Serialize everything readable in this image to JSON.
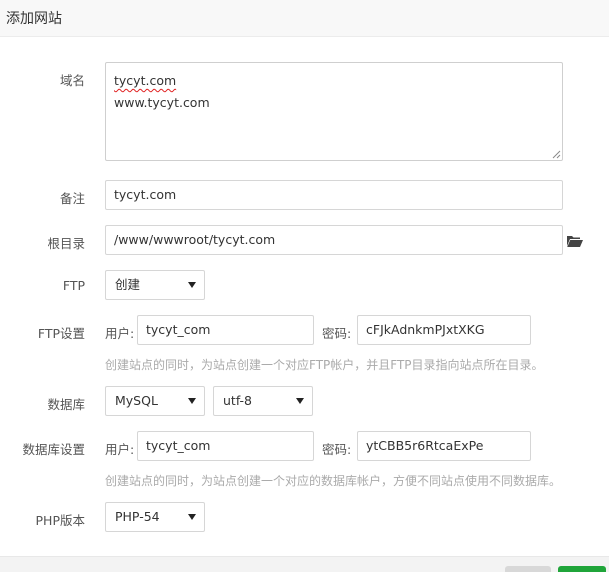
{
  "dialog": {
    "title": "添加网站"
  },
  "domain": {
    "label": "域名",
    "lines": [
      "tycyt.com",
      "www.tycyt.com"
    ]
  },
  "remark": {
    "label": "备注",
    "value": "tycyt.com"
  },
  "root": {
    "label": "根目录",
    "value": "/www/wwwroot/tycyt.com"
  },
  "ftp": {
    "label": "FTP",
    "selected": "创建"
  },
  "ftp_settings": {
    "label": "FTP设置",
    "user_label": "用户:",
    "user_value": "tycyt_com",
    "password_label": "密码:",
    "password_value": "cFJkAdnkmPJxtXKG",
    "hint": "创建站点的同时，为站点创建一个对应FTP帐户，并且FTP目录指向站点所在目录。"
  },
  "database": {
    "label": "数据库",
    "type_selected": "MySQL",
    "charset_selected": "utf-8"
  },
  "database_settings": {
    "label": "数据库设置",
    "user_label": "用户:",
    "user_value": "tycyt_com",
    "password_label": "密码:",
    "password_value": "ytCBB5r6RtcaExPe",
    "hint": "创建站点的同时，为站点创建一个对应的数据库帐户，方便不同站点使用不同数据库。"
  },
  "php": {
    "label": "PHP版本",
    "selected": "PHP-54"
  },
  "icons": {
    "folder": "folder-open-icon",
    "caret": "caret-down-icon",
    "resize": "resize-grip-icon"
  },
  "colors": {
    "accent_green": "#20a53a",
    "hint_grey": "#aaaaaa",
    "spell_error": "#e02020"
  }
}
